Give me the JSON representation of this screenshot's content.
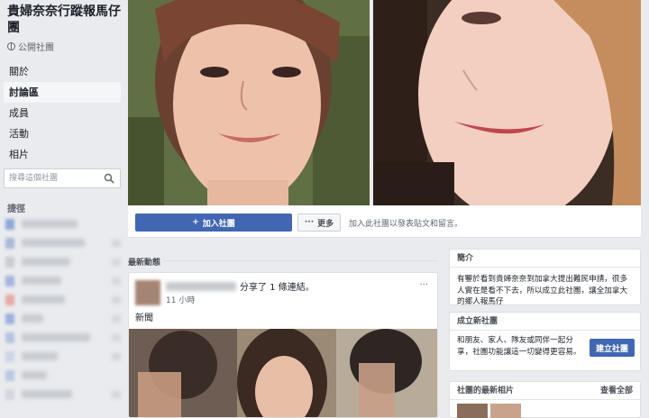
{
  "group": {
    "title": "貴婦奈奈行蹤報馬仔團",
    "type": "公開社團"
  },
  "nav": {
    "items": [
      "關於",
      "討論區",
      "成員",
      "活動",
      "相片"
    ]
  },
  "search": {
    "placeholder": "搜尋這個社團"
  },
  "shortcuts": {
    "title": "捷徑"
  },
  "action_bar": {
    "join_label": "加入社團",
    "more_label": "更多",
    "hint": "加入此社團以發表貼文和留言。"
  },
  "feed": {
    "title": "最新動態",
    "post": {
      "shared_text": "分享了 1 條連結。",
      "time": "11 小時",
      "text": "新聞",
      "menu": "···"
    }
  },
  "intro": {
    "title": "簡介",
    "text": "有鑒於看到貴婦奈奈到加拿大提出難民申請，很多人實在是看不下去，所以成立此社團，讓全加拿大的鄉人報馬仔"
  },
  "create_group": {
    "title": "成立新社團",
    "text": "和朋友、家人、隊友或同伴一起分享，社團功能讓這一切變得更容易。",
    "button": "建立社團"
  },
  "photos": {
    "title": "社團的最新相片",
    "see_all": "查看全部"
  },
  "colors": {
    "accent": "#4267b2",
    "background": "#e9ebee"
  }
}
